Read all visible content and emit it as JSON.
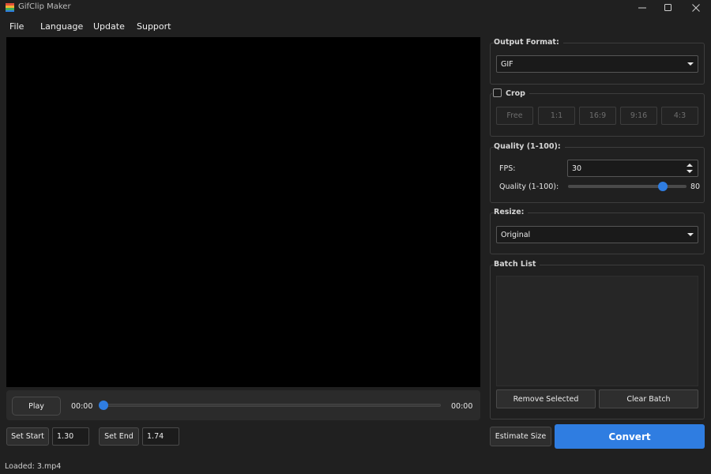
{
  "window": {
    "title": "GifClip Maker",
    "controls": {
      "minimize": "—",
      "maximize": "☐",
      "close": "✕"
    }
  },
  "menu": [
    "File",
    "Language",
    "Update",
    "Support"
  ],
  "playback": {
    "play_label": "Play",
    "current_time": "00:00",
    "total_time": "00:00",
    "position": 0.0
  },
  "trim": {
    "set_start_label": "Set Start",
    "start_value": "1.30",
    "set_end_label": "Set End",
    "end_value": "1.74"
  },
  "status": "Loaded: 3.mp4",
  "output_format": {
    "title": "Output Format:",
    "selected": "GIF"
  },
  "crop": {
    "label": "Crop",
    "checked": false,
    "ratios": [
      "Free",
      "1:1",
      "16:9",
      "9:16",
      "4:3"
    ]
  },
  "quality": {
    "title": "Quality (1-100):",
    "fps_label": "FPS:",
    "fps_value": "30",
    "quality_label": "Quality (1-100):",
    "quality_value": "80",
    "quality_level": 0.8
  },
  "resize": {
    "title": "Resize:",
    "selected": "Original"
  },
  "batch": {
    "title": "Batch List",
    "items": [],
    "remove_label": "Remove Selected",
    "clear_label": "Clear Batch"
  },
  "actions": {
    "estimate_label": "Estimate Size",
    "convert_label": "Convert"
  },
  "colors": {
    "accent": "#2f7de1",
    "background": "#202020",
    "video": "#000000"
  }
}
